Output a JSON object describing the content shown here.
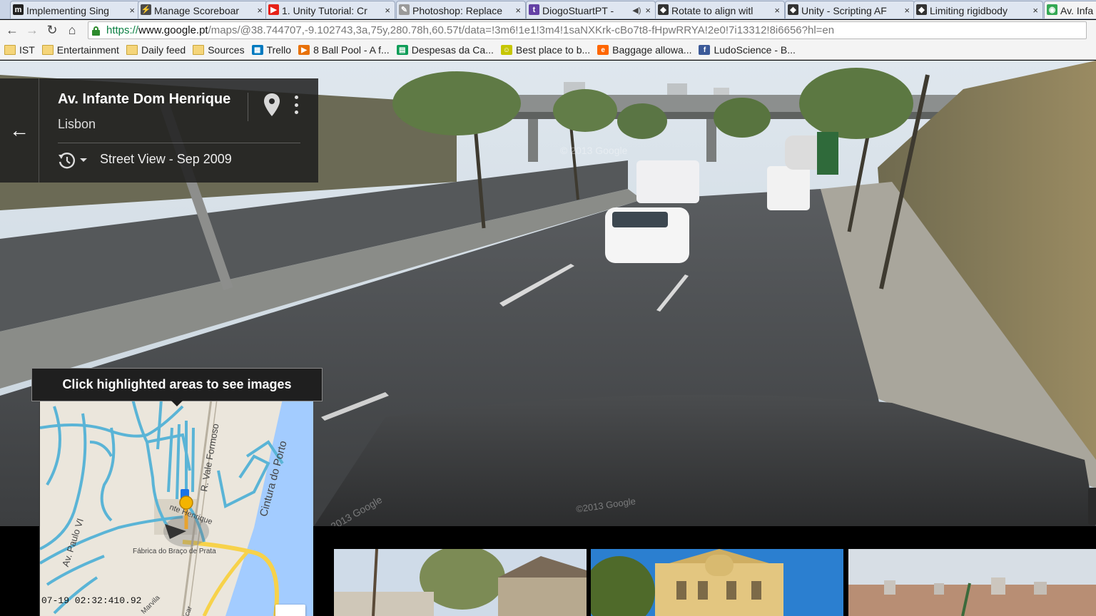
{
  "browser": {
    "tabs": [
      {
        "title": "Implementing Sing",
        "favicon_color": "#222222",
        "favicon_glyph": "m",
        "active": false,
        "audio": false
      },
      {
        "title": "Manage Scoreboar",
        "favicon_color": "#4a4a4a",
        "favicon_glyph": "⚡",
        "active": false,
        "audio": false
      },
      {
        "title": "1. Unity Tutorial: Cr",
        "favicon_color": "#e62117",
        "favicon_glyph": "▶",
        "active": false,
        "audio": false
      },
      {
        "title": "Photoshop: Replace",
        "favicon_color": "#9a9a9a",
        "favicon_glyph": "✎",
        "active": false,
        "audio": false
      },
      {
        "title": "DiogoStuartPT -",
        "favicon_color": "#6441a5",
        "favicon_glyph": "t",
        "active": false,
        "audio": true
      },
      {
        "title": "Rotate to align witl",
        "favicon_color": "#333333",
        "favicon_glyph": "◆",
        "active": false,
        "audio": false
      },
      {
        "title": "Unity - Scripting AF",
        "favicon_color": "#333333",
        "favicon_glyph": "◆",
        "active": false,
        "audio": false
      },
      {
        "title": "Limiting rigidbody",
        "favicon_color": "#333333",
        "favicon_glyph": "◆",
        "active": false,
        "audio": false
      },
      {
        "title": "Av. Infa",
        "favicon_color": "#34a853",
        "favicon_glyph": "◉",
        "active": true,
        "audio": false
      }
    ],
    "nav": {
      "back": "←",
      "forward": "→",
      "reload": "↻",
      "home": "⌂"
    },
    "url": {
      "scheme": "https://",
      "host": "www.google.pt",
      "rest": "/maps/@38.744707,-9.102743,3a,75y,280.78h,60.57t/data=!3m6!1e1!3m4!1saNXKrk-cBo7t8-fHpwRRYA!2e0!7i13312!8i6656?hl=en"
    },
    "bookmarks": [
      {
        "label": "IST",
        "icon": "folder-icon",
        "color": "#f5d57a"
      },
      {
        "label": "Entertainment",
        "icon": "folder-icon",
        "color": "#f5d57a"
      },
      {
        "label": "Daily feed",
        "icon": "folder-icon",
        "color": "#f5d57a"
      },
      {
        "label": "Sources",
        "icon": "folder-icon",
        "color": "#f5d57a"
      },
      {
        "label": "Trello",
        "icon": "trello-icon",
        "color": "#0079bf"
      },
      {
        "label": "8 Ball Pool - A f...",
        "icon": "play-icon",
        "color": "#e8710a"
      },
      {
        "label": "Despesas da Ca...",
        "icon": "sheets-icon",
        "color": "#0f9d58"
      },
      {
        "label": "Best place to b...",
        "icon": "smiley-icon",
        "color": "#c6c600"
      },
      {
        "label": "Baggage allowa...",
        "icon": "easyjet-icon",
        "color": "#ff6600"
      },
      {
        "label": "LudoScience - B...",
        "icon": "facebook-icon",
        "color": "#3b5998"
      }
    ]
  },
  "streetview": {
    "place_title": "Av. Infante Dom Henrique",
    "place_subtitle": "Lisbon",
    "date_label": "Street View - Sep 2009",
    "watermarks": [
      "© 2013 Google",
      "© 2013 Google",
      "©2013 Google"
    ]
  },
  "tooltip": {
    "text": "Click highlighted areas to see images"
  },
  "minimap": {
    "labels": [
      "R. Vale Formoso",
      "Cintura do Porto",
      "Av. Paulo VI",
      "Fábrica do Braço de Prata",
      "nte Henrique",
      "Marvila",
      "icar"
    ],
    "timestamp": "07-19 02:32:410.92",
    "road_color": "#5ab4d6",
    "water_color": "#a3ccff",
    "highway_color": "#f7d24a"
  }
}
